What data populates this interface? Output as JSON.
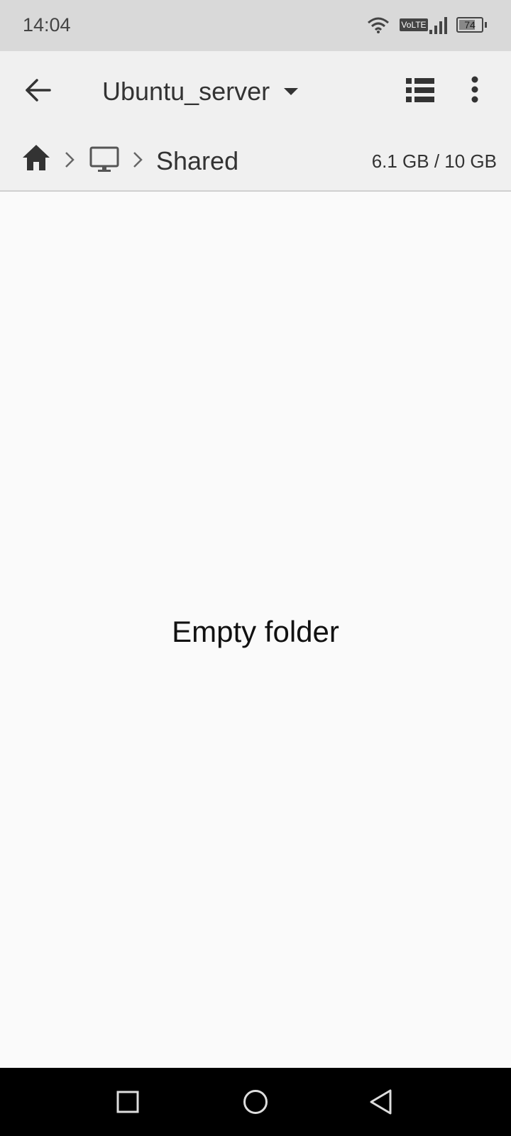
{
  "status_bar": {
    "time": "14:04",
    "network_badge": "VoLTE",
    "battery_level": "74",
    "battery_fraction": 0.74,
    "icons": [
      "wifi-icon",
      "signal-icon",
      "battery-icon"
    ]
  },
  "toolbar": {
    "title": "Ubuntu_server",
    "icons": [
      "back-arrow-icon",
      "dropdown-arrow-icon",
      "list-view-icon",
      "more-vert-icon"
    ]
  },
  "breadcrumb": {
    "items": [
      "home-icon",
      "computer-icon",
      "Shared"
    ],
    "current_label": "Shared",
    "storage": "6.1 GB / 10 GB"
  },
  "content": {
    "empty_message": "Empty folder"
  },
  "colors": {
    "status_bar_bg": "#d9d9d9",
    "toolbar_bg": "#f0f0f0",
    "content_bg": "#fafafa",
    "navbar_bg": "#000000"
  }
}
